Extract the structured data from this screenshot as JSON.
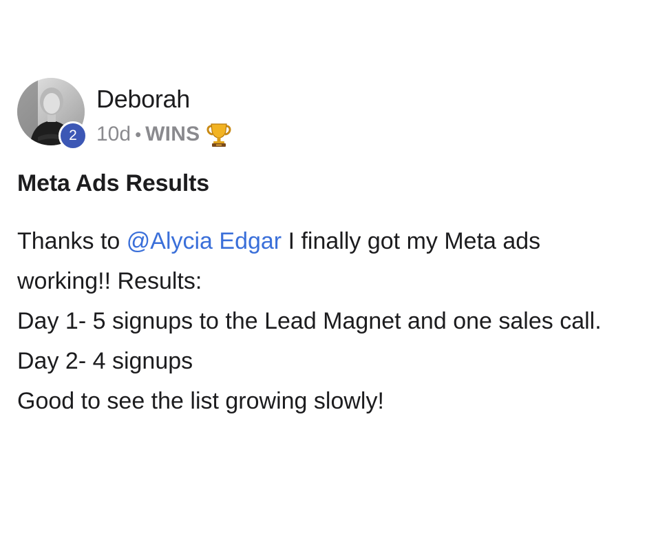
{
  "post": {
    "author": {
      "name": "Deborah",
      "level": "2",
      "avatar_icon": "profile-photo"
    },
    "meta": {
      "age": "10d",
      "separator": "•",
      "category": "WINS",
      "category_icon": "trophy-icon"
    },
    "title": "Meta Ads Results",
    "body": {
      "line1_prefix": "Thanks to ",
      "mention": "@Alycia Edgar",
      "line1_suffix": " I finally got my Meta ads working!! Results:",
      "lines": [
        "Day 1- 5 signups to the Lead Magnet and one sales call.",
        "Day 2- 4 signups",
        "Good to see the list growing slowly!"
      ]
    }
  },
  "colors": {
    "badge": "#3c57b5",
    "mention": "#3a6fd9",
    "meta_text": "#8a8a8e",
    "text": "#1c1c1e"
  }
}
